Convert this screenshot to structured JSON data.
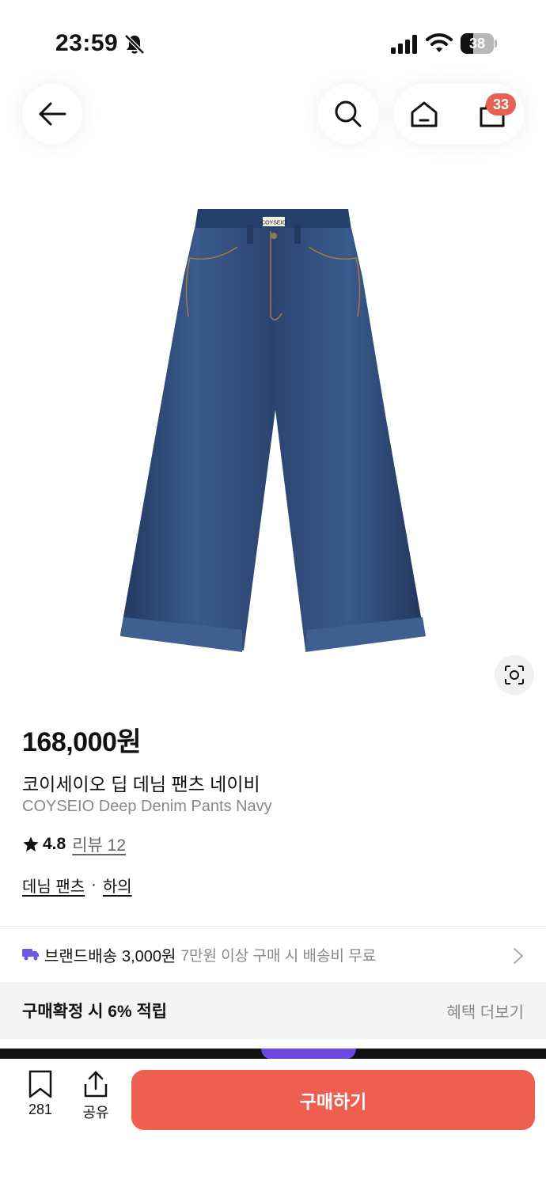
{
  "status_bar": {
    "time": "23:59",
    "battery_level": "38",
    "battery_fraction": 0.38
  },
  "nav": {
    "back_icon": "arrow-left-icon",
    "search_icon": "search-icon",
    "home_icon": "home-icon",
    "cart_icon": "shopping-bag-icon",
    "cart_count": "33"
  },
  "product": {
    "image_brand_tag": "COYSEIO",
    "price": "168,000원",
    "name_ko": "코이세이오 딥 데님 팬츠 네이비",
    "name_en": "COYSEIO Deep Denim Pants Navy",
    "rating": "4.8",
    "review_label": "리뷰 12",
    "categories": [
      "데님 팬츠",
      "하의"
    ],
    "category_separator": "·"
  },
  "shipping": {
    "label": "브랜드배송",
    "fee": "3,000원",
    "note": "7만원 이상 구매 시 배송비 무료"
  },
  "benefit": {
    "text": "구매확정 시 6% 적립",
    "more_label": "혜택 더보기"
  },
  "bottom_bar": {
    "bookmark_count": "281",
    "share_label": "공유",
    "buy_label": "구매하기"
  },
  "colors": {
    "accent": "#ee5f50",
    "badge": "#e96054",
    "denim": "#2c4470",
    "shipping_icon": "#6b5be6"
  }
}
